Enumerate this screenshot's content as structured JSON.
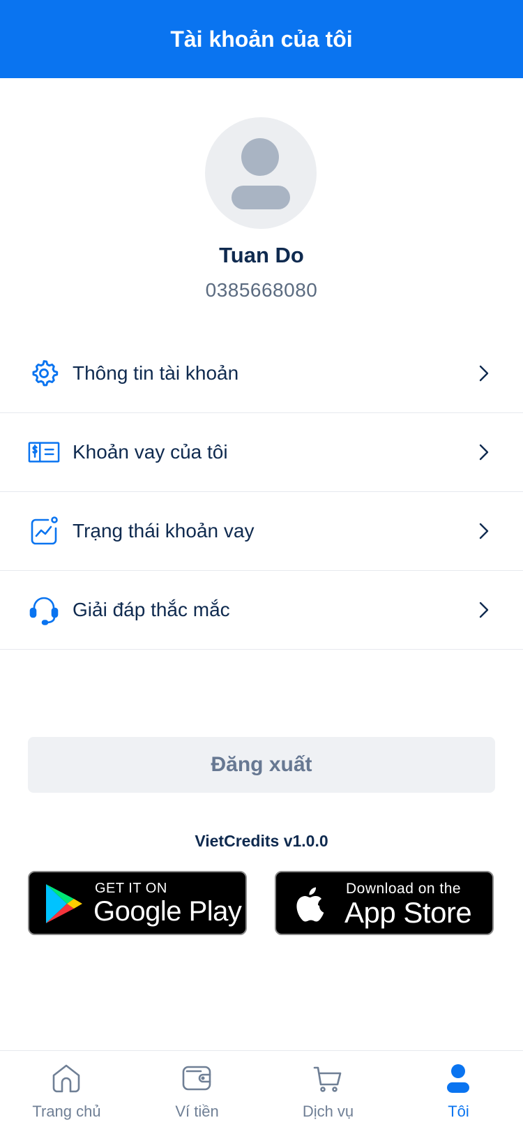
{
  "header": {
    "title": "Tài khoản của tôi"
  },
  "profile": {
    "name": "Tuan Do",
    "phone": "0385668080",
    "avatar_icon": "user-avatar-icon"
  },
  "menu": {
    "items": [
      {
        "label": "Thông tin tài khoản",
        "icon": "gear-icon"
      },
      {
        "label": "Khoản vay của tôi",
        "icon": "money-bill-icon"
      },
      {
        "label": "Trạng thái khoản vay",
        "icon": "chart-status-icon"
      },
      {
        "label": "Giải đáp thắc mắc",
        "icon": "headset-icon"
      }
    ],
    "chevron_icon": "chevron-right-icon"
  },
  "logout": {
    "label": "Đăng xuất"
  },
  "version": "VietCredits v1.0.0",
  "stores": {
    "google": {
      "small": "GET IT ON",
      "big": "Google Play"
    },
    "apple": {
      "small": "Download on the",
      "big": "App Store"
    }
  },
  "tabbar": {
    "tabs": [
      {
        "label": "Trang chủ",
        "icon": "home-icon",
        "active": false
      },
      {
        "label": "Ví tiền",
        "icon": "wallet-icon",
        "active": false
      },
      {
        "label": "Dịch vụ",
        "icon": "cart-icon",
        "active": false
      },
      {
        "label": "Tôi",
        "icon": "user-icon",
        "active": true
      }
    ]
  },
  "colors": {
    "accent": "#0a74f0",
    "text_primary": "#0f2a4f",
    "text_secondary": "#5b6b80",
    "logout_bg": "#eff1f4",
    "tab_inactive": "#6f7f95"
  }
}
